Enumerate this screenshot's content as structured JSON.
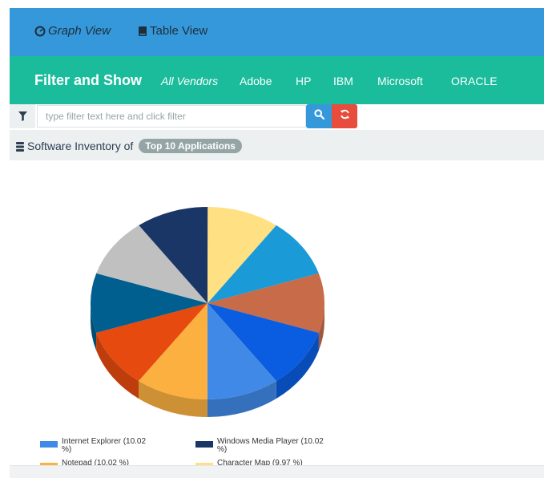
{
  "nav": {
    "graph_view": "Graph View",
    "table_view": "Table View"
  },
  "filter_bar": {
    "title": "Filter and Show",
    "vendors": [
      "All Vendors",
      "Adobe",
      "HP",
      "IBM",
      "Microsoft",
      "ORACLE"
    ],
    "active_vendor": "All Vendors"
  },
  "search": {
    "placeholder": "type filter text here and click filter",
    "value": ""
  },
  "inventory": {
    "label": "Software Inventory of",
    "badge": "Top 10 Applications"
  },
  "colors": {
    "topbar": "#3498db",
    "filterbar": "#1abc9c",
    "search_button": "#3498db",
    "reset_button": "#e74c3c"
  },
  "chart_data": {
    "type": "pie",
    "style": "3d",
    "slices": [
      {
        "label": "",
        "value": 10.0,
        "color": "#1a9ad6"
      },
      {
        "label": "",
        "value": 10.0,
        "color": "#c76b48"
      },
      {
        "label": "",
        "value": 10.0,
        "color": "#0a5de0"
      },
      {
        "label": "Internet Explorer",
        "value": 10.02,
        "color": "#4189e6"
      },
      {
        "label": "Notepad",
        "value": 10.02,
        "color": "#fbb03f"
      },
      {
        "label": "",
        "value": 10.0,
        "color": "#e64a0f"
      },
      {
        "label": "",
        "value": 10.0,
        "color": "#005f8e"
      },
      {
        "label": "",
        "value": 10.0,
        "color": "#c0c0c0"
      },
      {
        "label": "Windows Media Player",
        "value": 10.02,
        "color": "#1a3666"
      },
      {
        "label": "Character Map",
        "value": 9.97,
        "color": "#ffe083"
      }
    ],
    "legend": [
      {
        "text": "Internet Explorer (10.02 %)",
        "line1": "Internet Explorer (10.02",
        "line2": "%)",
        "color": "#4189e6"
      },
      {
        "text": "Windows Media Player (10.02 %)",
        "line1": "Windows Media Player (10.02",
        "line2": "%)",
        "color": "#1a3666"
      },
      {
        "text": "Notepad (10.02 %)",
        "line1": "Notepad (10.02 %)",
        "line2": "",
        "color": "#fbb03f"
      },
      {
        "text": "Character Map (9.97 %)",
        "line1": "Character Map (9.97 %)",
        "line2": "",
        "color": "#ffe083"
      }
    ],
    "legend_position": "bottom"
  }
}
